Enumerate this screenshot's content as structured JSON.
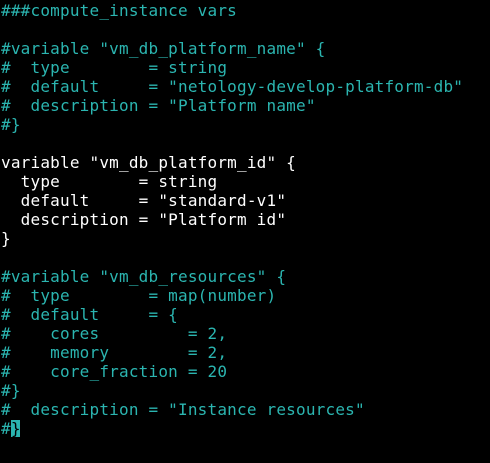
{
  "editor": {
    "colors": {
      "background": "#000000",
      "comment": "#2bb5b0",
      "code": "#ffffff",
      "cursor": "#2bb5b0"
    },
    "lines": [
      {
        "type": "comment",
        "text": "###compute_instance vars"
      },
      {
        "type": "blank",
        "text": ""
      },
      {
        "type": "comment",
        "text": "#variable \"vm_db_platform_name\" {"
      },
      {
        "type": "comment",
        "text": "#  type        = string"
      },
      {
        "type": "comment",
        "text": "#  default     = \"netology-develop-platform-db\""
      },
      {
        "type": "comment",
        "text": "#  description = \"Platform name\""
      },
      {
        "type": "comment",
        "text": "#}"
      },
      {
        "type": "blank",
        "text": ""
      },
      {
        "type": "code",
        "text": "variable \"vm_db_platform_id\" {"
      },
      {
        "type": "code",
        "text": "  type        = string"
      },
      {
        "type": "code",
        "text": "  default     = \"standard-v1\""
      },
      {
        "type": "code",
        "text": "  description = \"Platform id\""
      },
      {
        "type": "code",
        "text": "}"
      },
      {
        "type": "blank",
        "text": ""
      },
      {
        "type": "comment",
        "text": "#variable \"vm_db_resources\" {"
      },
      {
        "type": "comment",
        "text": "#  type        = map(number)"
      },
      {
        "type": "comment",
        "text": "#  default     = {"
      },
      {
        "type": "comment",
        "text": "#    cores         = 2,"
      },
      {
        "type": "comment",
        "text": "#    memory        = 2,"
      },
      {
        "type": "comment",
        "text": "#    core_fraction = 20"
      },
      {
        "type": "comment",
        "text": "#}"
      },
      {
        "type": "comment",
        "text": "#  description = \"Instance resources\""
      }
    ],
    "cursor_line": {
      "prefix": "#",
      "cursor_char": "}"
    }
  }
}
